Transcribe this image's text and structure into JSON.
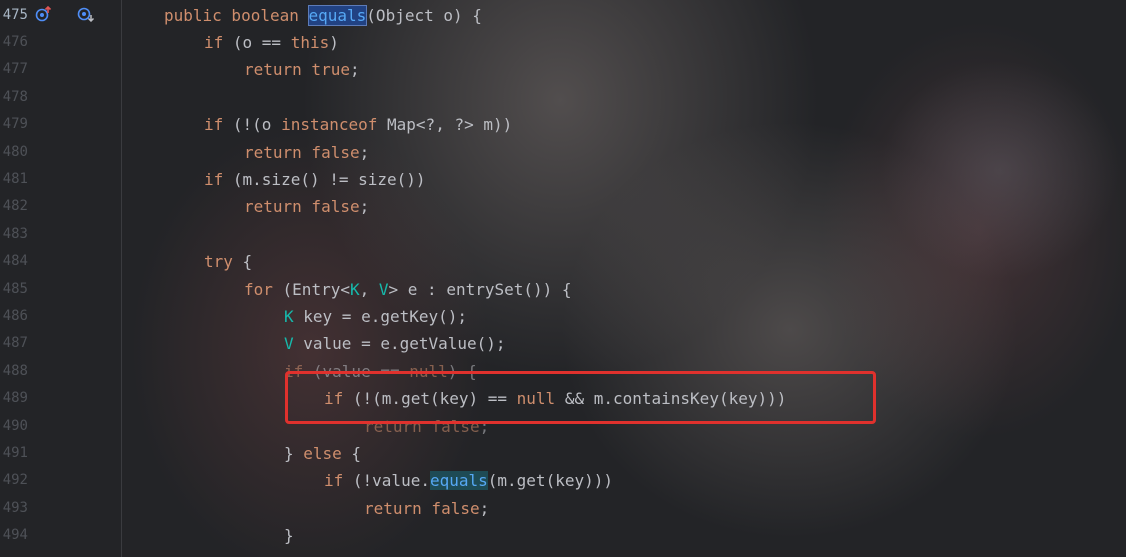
{
  "editor": {
    "current_line": "475",
    "icons": {
      "override_icon": "override-gutter-icon",
      "implementation_icon": "implementation-gutter-icon"
    },
    "lines": [
      {
        "number": "475",
        "tokens": [
          {
            "t": "public boolean ",
            "c": "kw"
          },
          {
            "t": "equals",
            "c": "sel"
          },
          {
            "t": "(Object o) {",
            "c": ""
          }
        ]
      },
      {
        "number": "476",
        "tokens": [
          {
            "t": "if",
            "c": "kw"
          },
          {
            "t": " (o == ",
            "c": ""
          },
          {
            "t": "this",
            "c": "kw"
          },
          {
            "t": ")",
            "c": ""
          }
        ]
      },
      {
        "number": "477",
        "tokens": [
          {
            "t": "return true",
            "c": "kw"
          },
          {
            "t": ";",
            "c": ""
          }
        ]
      },
      {
        "number": "478",
        "tokens": []
      },
      {
        "number": "479",
        "tokens": [
          {
            "t": "if",
            "c": "kw"
          },
          {
            "t": " (!(o ",
            "c": ""
          },
          {
            "t": "instanceof",
            "c": "kw"
          },
          {
            "t": " Map<?, ?> m))",
            "c": ""
          }
        ]
      },
      {
        "number": "480",
        "tokens": [
          {
            "t": "return false",
            "c": "kw"
          },
          {
            "t": ";",
            "c": ""
          }
        ]
      },
      {
        "number": "481",
        "tokens": [
          {
            "t": "if",
            "c": "kw"
          },
          {
            "t": " (m.size() != size())",
            "c": ""
          }
        ]
      },
      {
        "number": "482",
        "tokens": [
          {
            "t": "return false",
            "c": "kw"
          },
          {
            "t": ";",
            "c": ""
          }
        ]
      },
      {
        "number": "483",
        "tokens": []
      },
      {
        "number": "484",
        "tokens": [
          {
            "t": "try",
            "c": "kw"
          },
          {
            "t": " {",
            "c": ""
          }
        ]
      },
      {
        "number": "485",
        "tokens": [
          {
            "t": "for",
            "c": "kw"
          },
          {
            "t": " (Entry<",
            "c": ""
          },
          {
            "t": "K",
            "c": "tp"
          },
          {
            "t": ", ",
            "c": ""
          },
          {
            "t": "V",
            "c": "tp"
          },
          {
            "t": "> e : entrySet()) {",
            "c": ""
          }
        ]
      },
      {
        "number": "486",
        "tokens": [
          {
            "t": "K",
            "c": "tp"
          },
          {
            "t": " key = e.getKey();",
            "c": ""
          }
        ]
      },
      {
        "number": "487",
        "tokens": [
          {
            "t": "V",
            "c": "tp"
          },
          {
            "t": " value = e.getValue();",
            "c": ""
          }
        ]
      },
      {
        "number": "488",
        "tokens": [
          {
            "t": "if",
            "c": "kw"
          },
          {
            "t": " (value == ",
            "c": ""
          },
          {
            "t": "null",
            "c": "kw"
          },
          {
            "t": ") {",
            "c": ""
          }
        ]
      },
      {
        "number": "489",
        "tokens": [
          {
            "t": "if",
            "c": "kw"
          },
          {
            "t": " (!(m.get(key) == ",
            "c": ""
          },
          {
            "t": "null",
            "c": "kw"
          },
          {
            "t": " && m.containsKey(key)))",
            "c": ""
          }
        ]
      },
      {
        "number": "490",
        "tokens": [
          {
            "t": "return false",
            "c": "kw"
          },
          {
            "t": ";",
            "c": ""
          }
        ]
      },
      {
        "number": "491",
        "tokens": [
          {
            "t": "} ",
            "c": ""
          },
          {
            "t": "else",
            "c": "kw"
          },
          {
            "t": " {",
            "c": ""
          }
        ]
      },
      {
        "number": "492",
        "tokens": [
          {
            "t": "if",
            "c": "kw"
          },
          {
            "t": " (!value.",
            "c": ""
          },
          {
            "t": "equals",
            "c": "usage"
          },
          {
            "t": "(m.get(key)))",
            "c": ""
          }
        ]
      },
      {
        "number": "493",
        "tokens": [
          {
            "t": "return false",
            "c": "kw"
          },
          {
            "t": ";",
            "c": ""
          }
        ]
      },
      {
        "number": "494",
        "tokens": [
          {
            "t": "}",
            "c": ""
          }
        ]
      }
    ]
  },
  "colors": {
    "keyword": "#cf8e6d",
    "type_param": "#16baac",
    "method": "#56a8f5",
    "text": "#bcbec4",
    "line_number": "#4e5157",
    "annotation_box": "#e0312d"
  }
}
